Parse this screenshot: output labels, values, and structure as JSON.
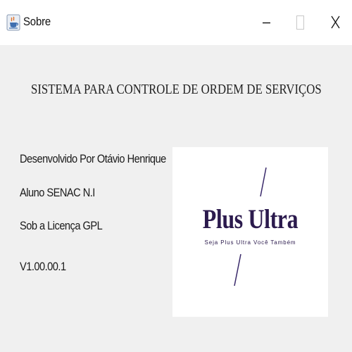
{
  "window": {
    "title": "Sobre",
    "icon": "java-cup-icon",
    "controls": {
      "minimize": "minimize-icon",
      "maximize": "maximize-icon",
      "close": "close-icon"
    }
  },
  "content": {
    "heading": "SISTEMA PARA CONTROLE DE ORDEM DE SERVIÇOS",
    "developer": "Desenvolvido Por Otávio Henrique",
    "student": "Aluno SENAC N.I",
    "license": "Sob a Licença GPL",
    "version": "V1.00.00.1"
  },
  "logo": {
    "name": "Plus Ultra",
    "tagline": "Seja Plus Ultra Você Também",
    "color": "#2b1a4d",
    "accent_line_color": "#3a2a6b"
  },
  "colors": {
    "window_background": "#f0f0f0",
    "titlebar_background": "#ffffff",
    "logo_background": "#ffffff"
  }
}
